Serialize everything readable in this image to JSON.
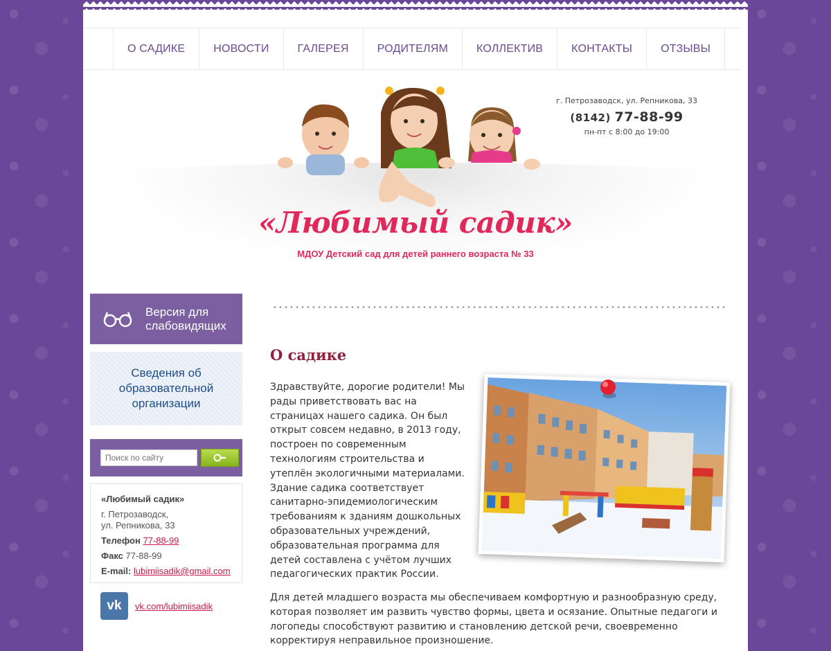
{
  "nav": {
    "items": [
      "О САДИКЕ",
      "НОВОСТИ",
      "ГАЛЕРЕЯ",
      "РОДИТЕЛЯМ",
      "КОЛЛЕКТИВ",
      "КОНТАКТЫ",
      "ОТЗЫВЫ"
    ]
  },
  "header": {
    "address": "г. Петрозаводск, ул. Репникова, 33",
    "phone_code": "(8142)",
    "phone_number": "77-88-99",
    "hours": "пн-пт с 8:00 до 19:00",
    "logo_title": "«Любимый садик»",
    "logo_subtitle": "МДОУ Детский сад для детей раннего возраста № 33"
  },
  "sidebar": {
    "vision_button_line1": "Версия для",
    "vision_button_line2": "слабовидящих",
    "edu_button_line1": "Сведения об",
    "edu_button_line2": "образовательной",
    "edu_button_line3": "организации",
    "search_placeholder": "Поиск по сайту",
    "contact": {
      "name": "«Любимый садик»",
      "address_line1": "г. Петрозаводск,",
      "address_line2": "ул. Репникова, 33",
      "phone_label": "Телефон",
      "phone_value": "77-88-99",
      "fax_label": "Факс",
      "fax_value": "77-88-99",
      "email_label": "E-mail:",
      "email_value": "lubimiisadik@gmail.com"
    },
    "vk_logo": "vk",
    "vk_link": "vk.com/lubimiisadik"
  },
  "main": {
    "title": "О садике",
    "intro": "Здравствуйте, дорогие родители! Мы рады приветствовать вас на страницах нашего садика. Он был открыт совсем недавно, в 2013 году, построен по современным технологиям строительства и утеплён экологичными материалами. Здание садика соответствует санитарно-эпидемиологическим требованиям к зданиям дошкольных образовательных учреждений, образовательная программа для детей составлена с учётом лучших педагогических практик России.",
    "paragraph2": "Для детей младшего возраста мы обеспечиваем комфортную и разнообразную среду, которая позволяет им развить чувство формы, цвета и осязание. Опытные педагоги и логопеды способствуют развитию и становлению детской речи, своевременно корректируя неправильное произношение."
  },
  "colors": {
    "brand_purple": "#6a4798",
    "accent_red": "#e0285a",
    "link_red": "#c8194a",
    "vk_blue": "#4a76a8"
  }
}
